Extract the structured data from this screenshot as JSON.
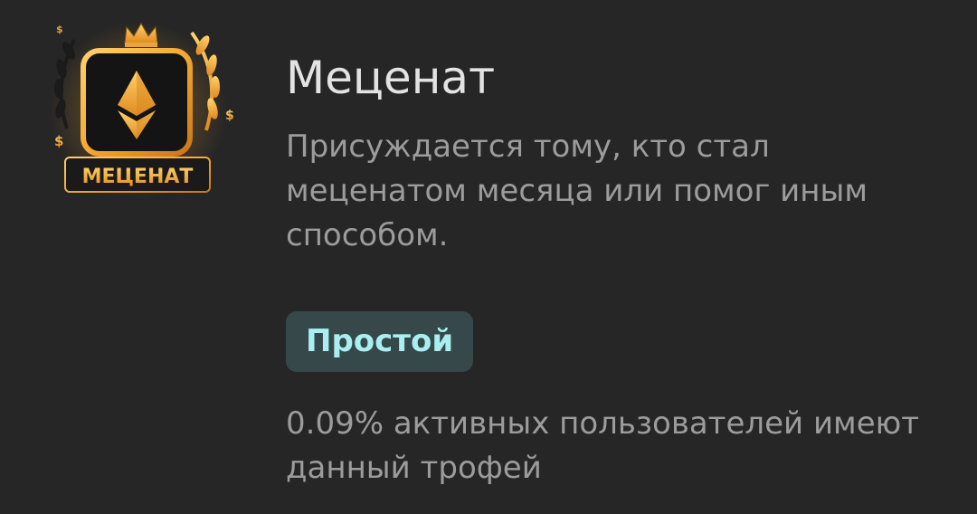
{
  "trophy": {
    "title": "Меценат",
    "description": "Присуждается тому, кто стал меценатом месяца или помог иным способом.",
    "rarity_label": "Простой",
    "stat_text": "0.09% активных пользователей имеют данный трофей",
    "icon": {
      "name": "patron-trophy-icon",
      "plaque_text": "МЕЦЕНАТ",
      "symbols": [
        "crown-icon",
        "ethereum-diamond-icon",
        "laurel-wreath-icon",
        "dollar-sign-icon"
      ]
    }
  },
  "colors": {
    "background": "#262626",
    "title": "#e3e3e3",
    "muted_text": "#9c9c9c",
    "rarity_bg": "#36484a",
    "rarity_text": "#a9eef0",
    "gold": "#f2b33d"
  }
}
